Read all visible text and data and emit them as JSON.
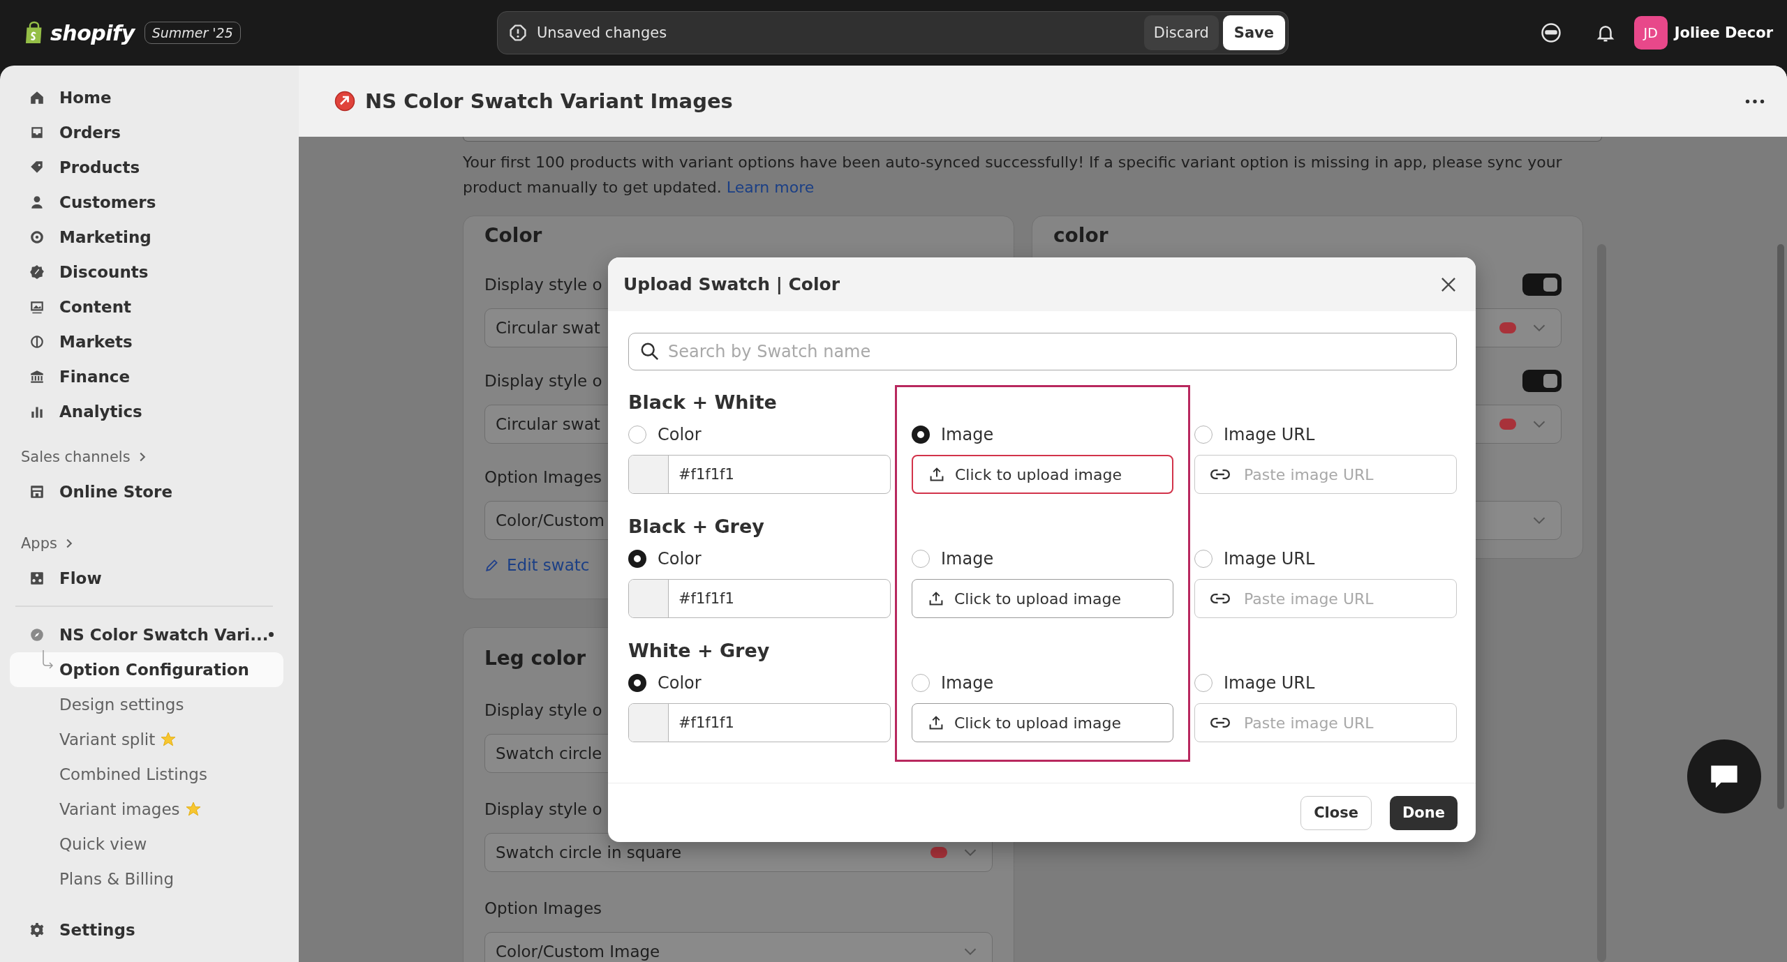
{
  "topbar": {
    "logo": "shopify",
    "edition": "Summer '25",
    "unsaved": {
      "message": "Unsaved changes",
      "discard": "Discard",
      "save": "Save"
    },
    "user": {
      "initials": "JD",
      "name": "Joliee Decor"
    }
  },
  "sidebar": {
    "items": [
      {
        "label": "Home"
      },
      {
        "label": "Orders"
      },
      {
        "label": "Products"
      },
      {
        "label": "Customers"
      },
      {
        "label": "Marketing"
      },
      {
        "label": "Discounts"
      },
      {
        "label": "Content"
      },
      {
        "label": "Markets"
      },
      {
        "label": "Finance"
      },
      {
        "label": "Analytics"
      }
    ],
    "sections": [
      {
        "title": "Sales channels",
        "items": [
          {
            "label": "Online Store"
          }
        ]
      },
      {
        "title": "Apps",
        "items": [
          {
            "label": "Flow"
          }
        ]
      }
    ],
    "app": {
      "label": "NS Color Swatch Vari...",
      "pinned": true,
      "children": [
        {
          "label": "Option Configuration",
          "selected": true,
          "starred": false
        },
        {
          "label": "Design settings",
          "selected": false,
          "starred": false
        },
        {
          "label": "Variant split",
          "selected": false,
          "starred": true
        },
        {
          "label": "Combined Listings",
          "selected": false,
          "starred": false
        },
        {
          "label": "Variant images",
          "selected": false,
          "starred": true
        },
        {
          "label": "Quick view",
          "selected": false,
          "starred": false
        },
        {
          "label": "Plans & Billing",
          "selected": false,
          "starred": false
        }
      ]
    },
    "settings": "Settings"
  },
  "header": {
    "title": "NS Color Swatch Variant Images"
  },
  "notice": {
    "text": "Your first 100 products with variant options have been auto-synced successfully! If a specific variant option is missing in app, please sync your product manually to get updated.",
    "link": "Learn more"
  },
  "cards": [
    {
      "title": "Color",
      "settings": [
        {
          "kind": "select",
          "label": "Display style o",
          "value": "Circular swat"
        },
        {
          "kind": "select",
          "label": "Display style o",
          "value": "Circular swat"
        },
        {
          "kind": "select",
          "label": "Option Images",
          "value": "Color/Custom"
        }
      ],
      "link": "Edit swatc"
    },
    {
      "title": "color",
      "settings": [
        {
          "kind": "select",
          "on": true,
          "color": "#a8323a",
          "chevron": true
        },
        {
          "kind": "select",
          "on": true,
          "color": "#a8323a",
          "chevron": true
        },
        {
          "kind": "select",
          "chevron": true
        }
      ]
    },
    {
      "title": "Leg color",
      "settings": [
        {
          "kind": "select",
          "label": "Display style o",
          "value": "Swatch circle"
        },
        {
          "kind": "select",
          "label": "Display style o",
          "value": "Swatch circle in square",
          "color": "#a8323a",
          "chevron": true
        },
        {
          "kind": "select",
          "label": "Option Images",
          "value": "Color/Custom Image",
          "chevron": true
        }
      ]
    }
  ],
  "modal": {
    "title": "Upload Swatch | Color",
    "search": {
      "placeholder": "Search by Swatch name"
    },
    "image_column_highlighted": true,
    "swatches": [
      {
        "name": "Black + White",
        "options": [
          {
            "kind": "color",
            "label": "Color",
            "selected": false,
            "value": "#f1f1f1"
          },
          {
            "kind": "image",
            "label": "Image",
            "selected": true,
            "button": "Click to upload image",
            "focused": true
          },
          {
            "kind": "url",
            "label": "Image URL",
            "selected": false,
            "placeholder": "Paste image URL"
          }
        ]
      },
      {
        "name": "Black + Grey",
        "options": [
          {
            "kind": "color",
            "label": "Color",
            "selected": true,
            "value": "#f1f1f1"
          },
          {
            "kind": "image",
            "label": "Image",
            "selected": false,
            "button": "Click to upload image",
            "focused": false
          },
          {
            "kind": "url",
            "label": "Image URL",
            "selected": false,
            "placeholder": "Paste image URL"
          }
        ]
      },
      {
        "name": "White + Grey",
        "options": [
          {
            "kind": "color",
            "label": "Color",
            "selected": true,
            "value": "#f1f1f1"
          },
          {
            "kind": "image",
            "label": "Image",
            "selected": false,
            "button": "Click to upload image",
            "focused": false
          },
          {
            "kind": "url",
            "label": "Image URL",
            "selected": false,
            "placeholder": "Paste image URL"
          }
        ]
      }
    ],
    "buttons": {
      "close": "Close",
      "done": "Done"
    }
  }
}
